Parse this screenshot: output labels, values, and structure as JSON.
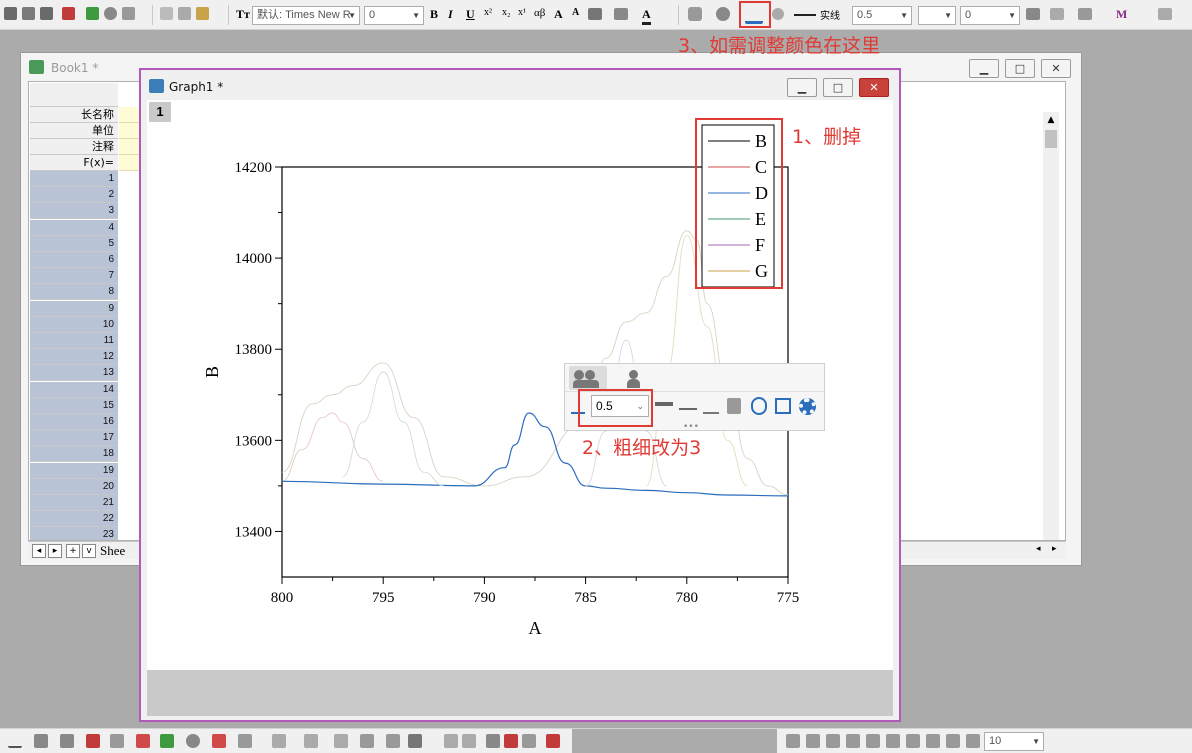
{
  "toolbar": {
    "font_name": "默认: Times New R",
    "font_size": "0",
    "line_style": "实线",
    "line_width": "0.5",
    "pattern_value": "0",
    "alpha_label": "αβ"
  },
  "annotations": {
    "color_tip": "3、如需调整颜色在这里",
    "delete_tip": "1、删掉",
    "width_tip": "2、粗细改为3"
  },
  "book1": {
    "title": "Book1 *",
    "row_labels": [
      "长名称",
      "单位",
      "注释",
      "F(x)="
    ],
    "rows": [
      "1",
      "2",
      "3",
      "4",
      "5",
      "6",
      "7",
      "8",
      "9",
      "10",
      "11",
      "12",
      "13",
      "14",
      "15",
      "16",
      "17",
      "18",
      "19",
      "20",
      "21",
      "22",
      "23"
    ],
    "sheet_tab": "Shee"
  },
  "graph1": {
    "title": "Graph1 *",
    "layer_index": "1"
  },
  "mini_toolbar": {
    "line_width": "0.5"
  },
  "bottom_toolbar": {
    "zoom_value": "10"
  },
  "colors": {
    "accent_red": "#e03a35",
    "graph_border": "#b15ab8",
    "series_D": "#2a6dbd",
    "series_B": "#000000",
    "series_C": "#d14b4b",
    "series_E": "#3c9a6a",
    "series_F": "#a06ab8",
    "series_G": "#c9a24a"
  },
  "chart_data": {
    "type": "line",
    "xlabel": "A",
    "ylabel": "B",
    "xlim": [
      800,
      775
    ],
    "ylim": [
      13300,
      14200
    ],
    "x_ticks": [
      "800",
      "795",
      "790",
      "785",
      "780",
      "775"
    ],
    "y_ticks": [
      "13400",
      "13600",
      "13800",
      "14000",
      "14200"
    ],
    "legend": [
      "B",
      "C",
      "D",
      "E",
      "F",
      "G"
    ],
    "legend_position": "top-right",
    "series": [
      {
        "name": "B",
        "color": "#d9d3c2",
        "x": [
          800,
          798.5,
          797.5,
          796.5,
          795,
          793.5,
          792,
          790,
          788,
          785,
          784,
          783,
          782,
          781,
          780,
          779.5,
          779,
          778,
          777,
          776,
          775
        ],
        "y": [
          13530,
          13680,
          13700,
          13720,
          13770,
          13650,
          13520,
          13500,
          13520,
          13640,
          13780,
          13860,
          13880,
          13960,
          14060,
          14040,
          13900,
          13720,
          13560,
          13500,
          13480
        ]
      },
      {
        "name": "C",
        "color": "#e3c9c4",
        "x": [
          800,
          799,
          798,
          797.5,
          797,
          796,
          795
        ],
        "y": [
          13510,
          13580,
          13650,
          13660,
          13640,
          13560,
          13510
        ]
      },
      {
        "name": "D",
        "color": "#2a6dbd",
        "x": [
          800,
          795,
          790.5,
          789,
          788.5,
          787.8,
          787,
          786,
          785,
          784,
          782,
          780,
          778,
          775
        ],
        "y": [
          13510,
          13504,
          13500,
          13540,
          13590,
          13660,
          13630,
          13550,
          13500,
          13495,
          13490,
          13485,
          13480,
          13478
        ]
      },
      {
        "name": "E",
        "color": "#cfe0d6",
        "x": [
          797,
          796,
          795,
          794,
          793,
          792
        ],
        "y": [
          13520,
          13640,
          13750,
          13640,
          13530,
          13500
        ]
      },
      {
        "name": "F",
        "color": "#e0d2e6",
        "x": [
          785,
          784,
          783,
          782,
          781
        ],
        "y": [
          13500,
          13620,
          13820,
          13620,
          13500
        ]
      },
      {
        "name": "G",
        "color": "#e6dbbf",
        "x": [
          782,
          781,
          780,
          779,
          778,
          777
        ],
        "y": [
          13500,
          13750,
          14050,
          13850,
          13600,
          13500
        ]
      }
    ]
  }
}
